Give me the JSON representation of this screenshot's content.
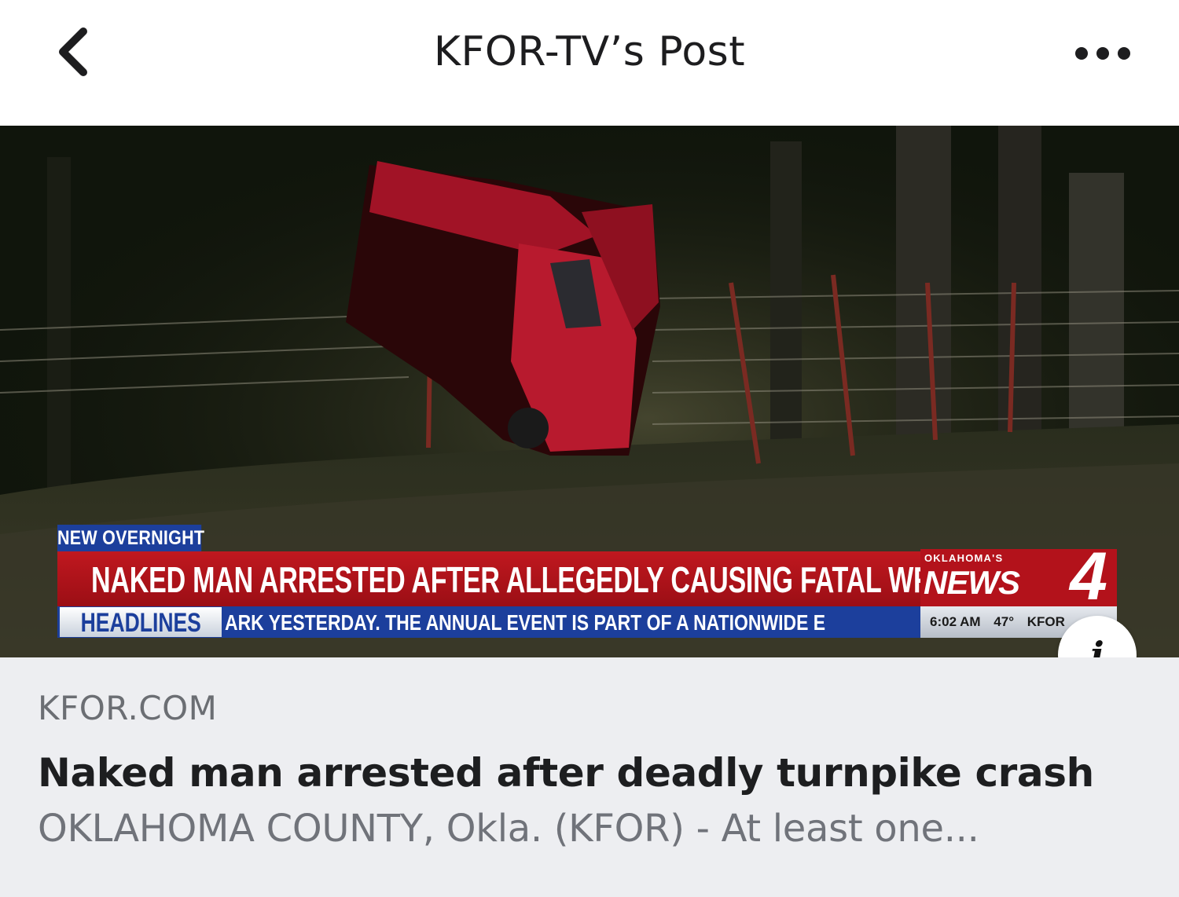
{
  "header": {
    "back_icon": "chevron-left-icon",
    "title": "KFOR-TV’s Post",
    "more_icon": "ellipsis-icon"
  },
  "card": {
    "image": {
      "tag": "NEW OVERNIGHT",
      "banner_headline": "NAKED MAN ARRESTED AFTER ALLEGEDLY CAUSING FATAL WRECK",
      "ticker_label": "HEADLINES",
      "ticker_text": "ARK YESTERDAY. THE ANNUAL EVENT IS PART OF A NATIONWIDE E",
      "brand_small": "OKLAHOMA'S",
      "brand_news": "NEWS",
      "brand_number": "4",
      "time": "6:02 AM",
      "temperature": "47°",
      "station": "KFOR"
    },
    "info_icon": "info-icon",
    "domain": "KFOR.COM",
    "headline": "Naked man arrested after deadly turnpike crash",
    "description": "OKLAHOMA COUNTY, Okla. (KFOR) - At least one..."
  }
}
